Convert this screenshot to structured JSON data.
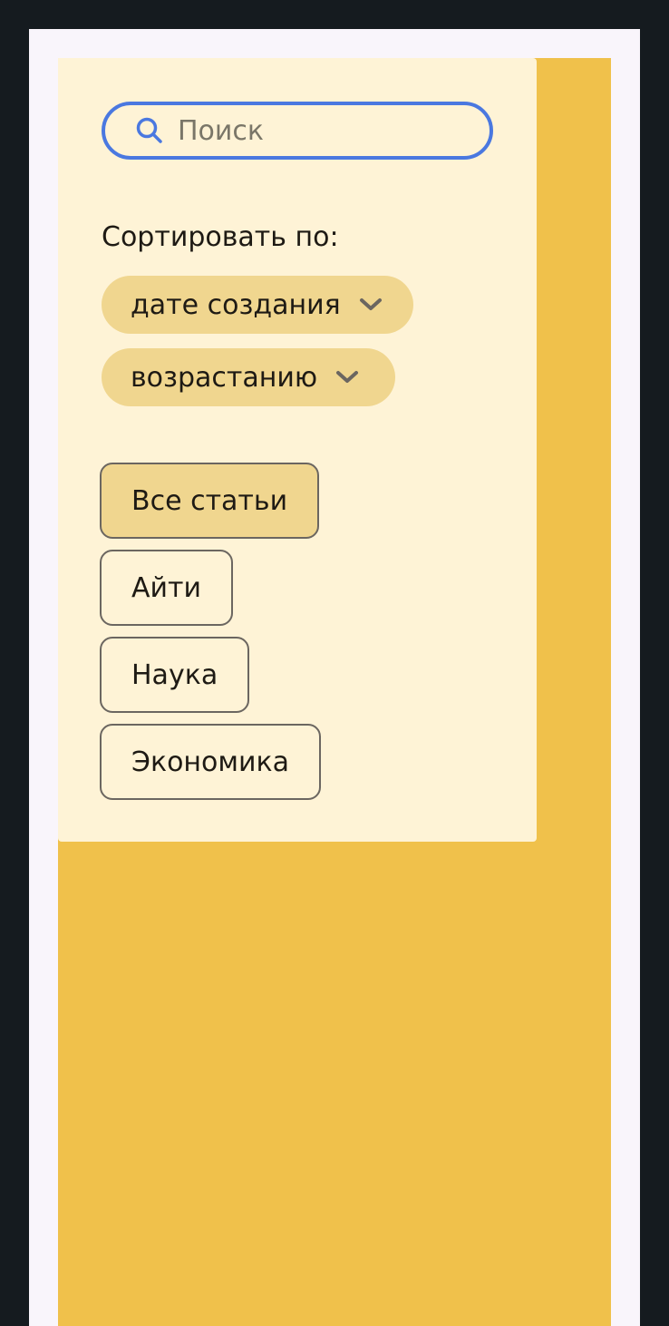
{
  "search": {
    "placeholder": "Поиск",
    "value": ""
  },
  "sort": {
    "label": "Сортировать по:",
    "field": "дате создания",
    "order": "возрастанию"
  },
  "categories": [
    {
      "label": "Все статьи",
      "active": true
    },
    {
      "label": "Айти",
      "active": false
    },
    {
      "label": "Наука",
      "active": false
    },
    {
      "label": "Экономика",
      "active": false
    }
  ],
  "colors": {
    "page_bg": "#151b1f",
    "frame_bg": "#f9f5fb",
    "content_bg": "#f0c14b",
    "sidebar_bg": "#fef3d6",
    "accent": "#4a78e0",
    "pill_bg": "#f0d68f"
  },
  "icons": {
    "search": "search-icon",
    "dropdown": "chevron-down-icon"
  }
}
